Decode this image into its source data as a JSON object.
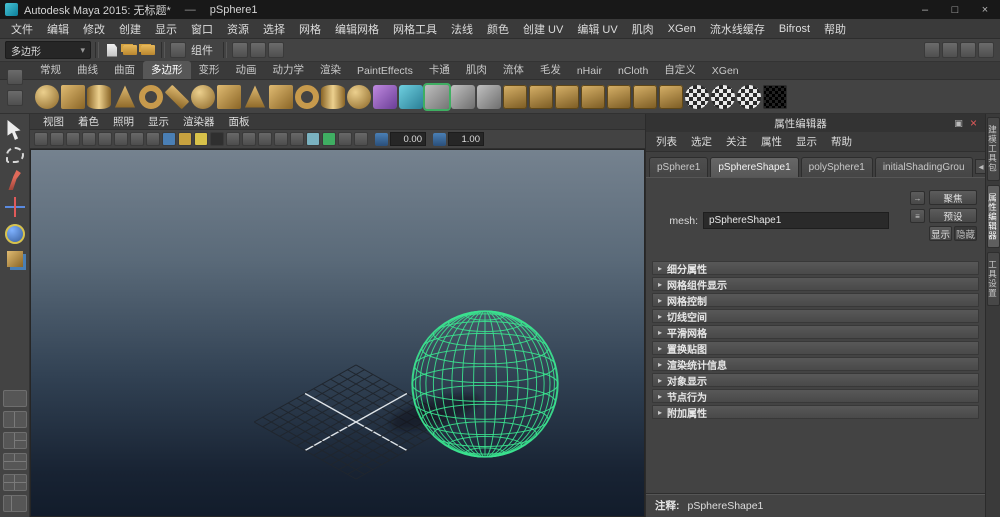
{
  "colors": {
    "wire_green": "#3be28f",
    "viewport_top": "#75828f",
    "viewport_bottom": "#121c2b",
    "shelf_gold": "#c79a4c",
    "close_red": "#e05a5a"
  },
  "title_bar": {
    "title": "Autodesk Maya 2015: 无标题*",
    "separator": "—",
    "document": "pSphere1",
    "minimize": "–",
    "maximize": "□",
    "close": "×"
  },
  "menu_bar": {
    "items": [
      "文件",
      "编辑",
      "修改",
      "创建",
      "显示",
      "窗口",
      "资源",
      "选择",
      "网格",
      "编辑网格",
      "网格工具",
      "法线",
      "颜色",
      "创建 UV",
      "编辑 UV",
      "肌肉",
      "XGen",
      "流水线缓存",
      "Bifrost",
      "帮助"
    ]
  },
  "status_line": {
    "selection_mask": "多边形",
    "file_icons": [
      {
        "n": "new-scene-icon",
        "style": "doc"
      },
      {
        "n": "open-scene-icon",
        "style": "folder"
      },
      {
        "n": "save-scene-icon",
        "style": "folder"
      }
    ],
    "mode_label": "组件",
    "mask_icons": [
      {
        "n": "highlight-selection-mode-icon"
      },
      {
        "n": "select-by-hierarchy-icon"
      },
      {
        "n": "select-by-object-icon"
      }
    ],
    "right_icons": [
      {
        "n": "toggle-modeling-toolkit-icon"
      },
      {
        "n": "toggle-attribute-editor-icon"
      },
      {
        "n": "toggle-tool-settings-icon"
      },
      {
        "n": "toggle-channel-box-icon"
      }
    ]
  },
  "shelf": {
    "active_tab": "多边形",
    "tabs": [
      "常规",
      "曲线",
      "曲面",
      "多边形",
      "变形",
      "动画",
      "动力学",
      "渲染",
      "PaintEffects",
      "卡通",
      "肌肉",
      "流体",
      "毛发",
      "nHair",
      "nCloth",
      "自定义",
      "XGen"
    ],
    "icons": [
      {
        "n": "poly-sphere-icon",
        "style": "sphere"
      },
      {
        "n": "poly-cube-icon",
        "style": "cube"
      },
      {
        "n": "poly-cylinder-icon",
        "style": "cyl"
      },
      {
        "n": "poly-cone-icon",
        "style": "cone"
      },
      {
        "n": "poly-torus-icon",
        "style": "torus"
      },
      {
        "n": "poly-plane-icon",
        "style": "plane"
      },
      {
        "n": "poly-disc-icon",
        "style": "sphere"
      },
      {
        "n": "platonic-solid-icon",
        "style": "cube"
      },
      {
        "n": "poly-pyramid-icon",
        "style": "cone"
      },
      {
        "n": "poly-prism-icon",
        "style": "cube"
      },
      {
        "n": "poly-pipe-icon",
        "style": "torus"
      },
      {
        "n": "poly-helix-icon",
        "style": "cyl"
      },
      {
        "n": "poly-soccer-ball-icon",
        "style": "sphere"
      },
      {
        "n": "sculpt-objects-icon",
        "style": "purple"
      },
      {
        "n": "smooth-sculpt-icon",
        "style": "teal"
      },
      {
        "n": "multi-cut-tool-icon",
        "style": "active"
      },
      {
        "n": "combine-icon",
        "style": "gray"
      },
      {
        "n": "separate-icon",
        "style": "gray"
      },
      {
        "n": "extract-icon",
        "style": "goldflat"
      },
      {
        "n": "smooth-icon",
        "style": "goldflat"
      },
      {
        "n": "extrude-icon",
        "style": "goldflat"
      },
      {
        "n": "bevel-icon",
        "style": "goldflat"
      },
      {
        "n": "bridge-icon",
        "style": "goldflat"
      },
      {
        "n": "mirror-geometry-icon",
        "style": "goldflat"
      },
      {
        "n": "spin-edge-icon",
        "style": "goldflat"
      },
      {
        "n": "uv-checker-icon-1",
        "style": "checker"
      },
      {
        "n": "uv-checker-icon-2",
        "style": "checker"
      },
      {
        "n": "uv-checker-icon-3",
        "style": "checker"
      },
      {
        "n": "uv-snapshot-icon",
        "style": "dark"
      }
    ]
  },
  "toolbox": {
    "tools": [
      {
        "n": "select-tool-icon",
        "style": "select"
      },
      {
        "n": "lasso-select-tool-icon",
        "style": "lasso"
      },
      {
        "n": "paint-select-tool-icon",
        "style": "paint"
      },
      {
        "n": "move-tool-icon",
        "style": "move"
      },
      {
        "n": "rotate-tool-icon",
        "style": "rotate"
      },
      {
        "n": "scale-tool-icon",
        "style": "scale"
      }
    ],
    "layouts": [
      {
        "n": "single-pane-layout-button",
        "style": "single"
      },
      {
        "n": "two-pane-layout-button",
        "style": "two-v"
      },
      {
        "n": "three-pane-left-layout-button",
        "style": "three-left"
      },
      {
        "n": "three-pane-bottom-layout-button",
        "style": "three-bottom"
      },
      {
        "n": "four-pane-layout-button",
        "style": "four"
      },
      {
        "n": "outliner-persp-layout-button",
        "style": "outliner"
      }
    ]
  },
  "viewport": {
    "menu": [
      "视图",
      "着色",
      "照明",
      "显示",
      "渲染器",
      "面板"
    ],
    "toolbar_icons": [
      {
        "n": "grid-toggle-icon"
      },
      {
        "n": "film-gate-icon"
      },
      {
        "n": "resolution-gate-icon"
      },
      {
        "n": "gate-mask-icon"
      },
      {
        "n": "field-chart-icon"
      },
      {
        "n": "safe-action-icon"
      },
      {
        "n": "safe-title-icon"
      },
      {
        "n": "wireframe-mode-icon"
      },
      {
        "n": "shaded-mode-icon",
        "c": "#4a7fb5"
      },
      {
        "n": "textured-mode-icon",
        "c": "#c8a23f"
      },
      {
        "n": "use-all-lights-icon",
        "c": "#d8c24a"
      },
      {
        "n": "shadows-icon",
        "c": "#2f2f2f"
      },
      {
        "n": "ambient-occlusion-icon"
      },
      {
        "n": "motion-blur-icon"
      },
      {
        "n": "multisample-icon"
      },
      {
        "n": "sequence-time-icon"
      },
      {
        "n": "isolate-select-icon"
      },
      {
        "n": "xray-icon",
        "c": "#7ab2c0"
      },
      {
        "n": "wireframe-on-shaded-icon",
        "c": "#3fae62"
      },
      {
        "n": "default-material-icon"
      },
      {
        "n": "paint-effects-off-icon"
      }
    ],
    "exposure_value": "0.00",
    "gamma_value": "1.00"
  },
  "attribute_editor": {
    "panel_title": "属性编辑器",
    "header_icons": [
      {
        "n": "copy-tab-icon",
        "g": "▣"
      },
      {
        "n": "close-attribute-editor-icon",
        "g": "×",
        "cls": "close"
      }
    ],
    "menu": [
      "列表",
      "选定",
      "关注",
      "属性",
      "显示",
      "帮助"
    ],
    "tabs": [
      "pSphere1",
      "pSphereShape1",
      "polySphere1",
      "initialShadingGrou"
    ],
    "active_tab": "pSphereShape1",
    "scroll_left": "◀",
    "scroll_right": "▶",
    "mesh_label": "mesh:",
    "mesh_value": "pSphereShape1",
    "side_icons": [
      {
        "n": "select-node-icon",
        "g": "→"
      },
      {
        "n": "copy-attributes-icon",
        "g": "≡"
      }
    ],
    "focus_button": "聚焦",
    "presets_button": "预设",
    "show_button": "显示",
    "hide_button": "隐藏",
    "sections": [
      "细分属性",
      "网格组件显示",
      "网格控制",
      "切线空间",
      "平滑网格",
      "置换贴图",
      "渲染统计信息",
      "对象显示",
      "节点行为",
      "附加属性"
    ],
    "notes_label": "注释:",
    "notes_value": "pSphereShape1"
  },
  "right_sidebar": {
    "active_tab": "属性编辑器",
    "tabs": [
      "建模工具包",
      "属性编辑器",
      "工具设置"
    ]
  }
}
